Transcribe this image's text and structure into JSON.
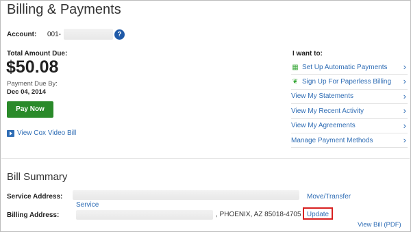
{
  "page": {
    "title": "Billing & Payments"
  },
  "account": {
    "label": "Account:",
    "number_prefix": "001-",
    "help_icon": "?"
  },
  "billing": {
    "total_label": "Total Amount Due:",
    "amount": "$50.08",
    "due_label": "Payment Due By:",
    "due_date": "Dec 04, 2014",
    "pay_button": "Pay Now",
    "video_link": "View Cox Video Bill"
  },
  "i_want": {
    "heading": "I want to:",
    "items": [
      {
        "label": "Set Up Automatic Payments",
        "icon": "calendar-icon"
      },
      {
        "label": "Sign Up For Paperless Billing",
        "icon": "leaf-icon"
      },
      {
        "label": "View My Statements",
        "icon": ""
      },
      {
        "label": "View My Recent Activity",
        "icon": ""
      },
      {
        "label": "View My Agreements",
        "icon": ""
      },
      {
        "label": "Manage Payment Methods",
        "icon": ""
      }
    ]
  },
  "summary": {
    "title": "Bill Summary",
    "service_label": "Service Address:",
    "billing_label": "Billing Address:",
    "move_link": "Move/Transfer",
    "service_link": "Service",
    "billing_city": ", PHOENIX, AZ 85018-4705",
    "update_link": "Update",
    "view_bill": "View Bill (PDF)"
  },
  "colors": {
    "link": "#2f6db5",
    "pay_button": "#2a8a2a",
    "highlight": "#d82020",
    "help": "#1f5aa8"
  }
}
